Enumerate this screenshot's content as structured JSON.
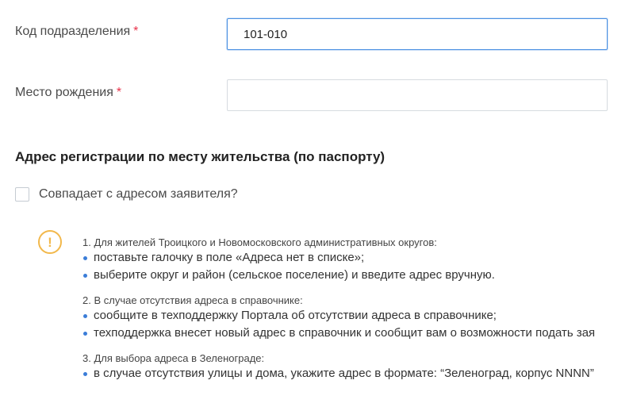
{
  "fields": {
    "division_code": {
      "label": "Код подразделения",
      "required_mark": "*",
      "value": "101-010"
    },
    "birth_place": {
      "label": "Место рождения",
      "required_mark": "*",
      "value": ""
    }
  },
  "address_section": {
    "title": "Адрес регистрации по месту жительства (по паспорту)",
    "same_address_checkbox": {
      "label": "Совпадает с адресом заявителя?",
      "checked": false
    }
  },
  "notice": {
    "icon": "exclamation-icon",
    "icon_glyph": "!",
    "groups": [
      {
        "heading": "1. Для жителей Троицкого и Новомосковского административных округов:",
        "items": [
          "поставьте галочку в поле «Адреса нет в списке»;",
          "выберите округ и район (сельское поселение) и введите адрес вручную."
        ]
      },
      {
        "heading": "2. В случае отсутствия адреса в справочнике:",
        "items": [
          "сообщите в техподдержку Портала об отсутствии адреса в справочнике;",
          "техподдержка внесет новый адрес в справочник и сообщит вам о возможности подать зая"
        ]
      },
      {
        "heading": "3. Для выбора адреса в Зеленограде:",
        "items": [
          "в случае отсутствия улицы и дома, укажите адрес в формате: “Зеленоград, корпус NNNN”"
        ]
      }
    ]
  },
  "colors": {
    "required": "#e8324a",
    "focus_border": "#4a90e2",
    "warning": "#f2b84b",
    "bullet": "#3b7dd8"
  }
}
